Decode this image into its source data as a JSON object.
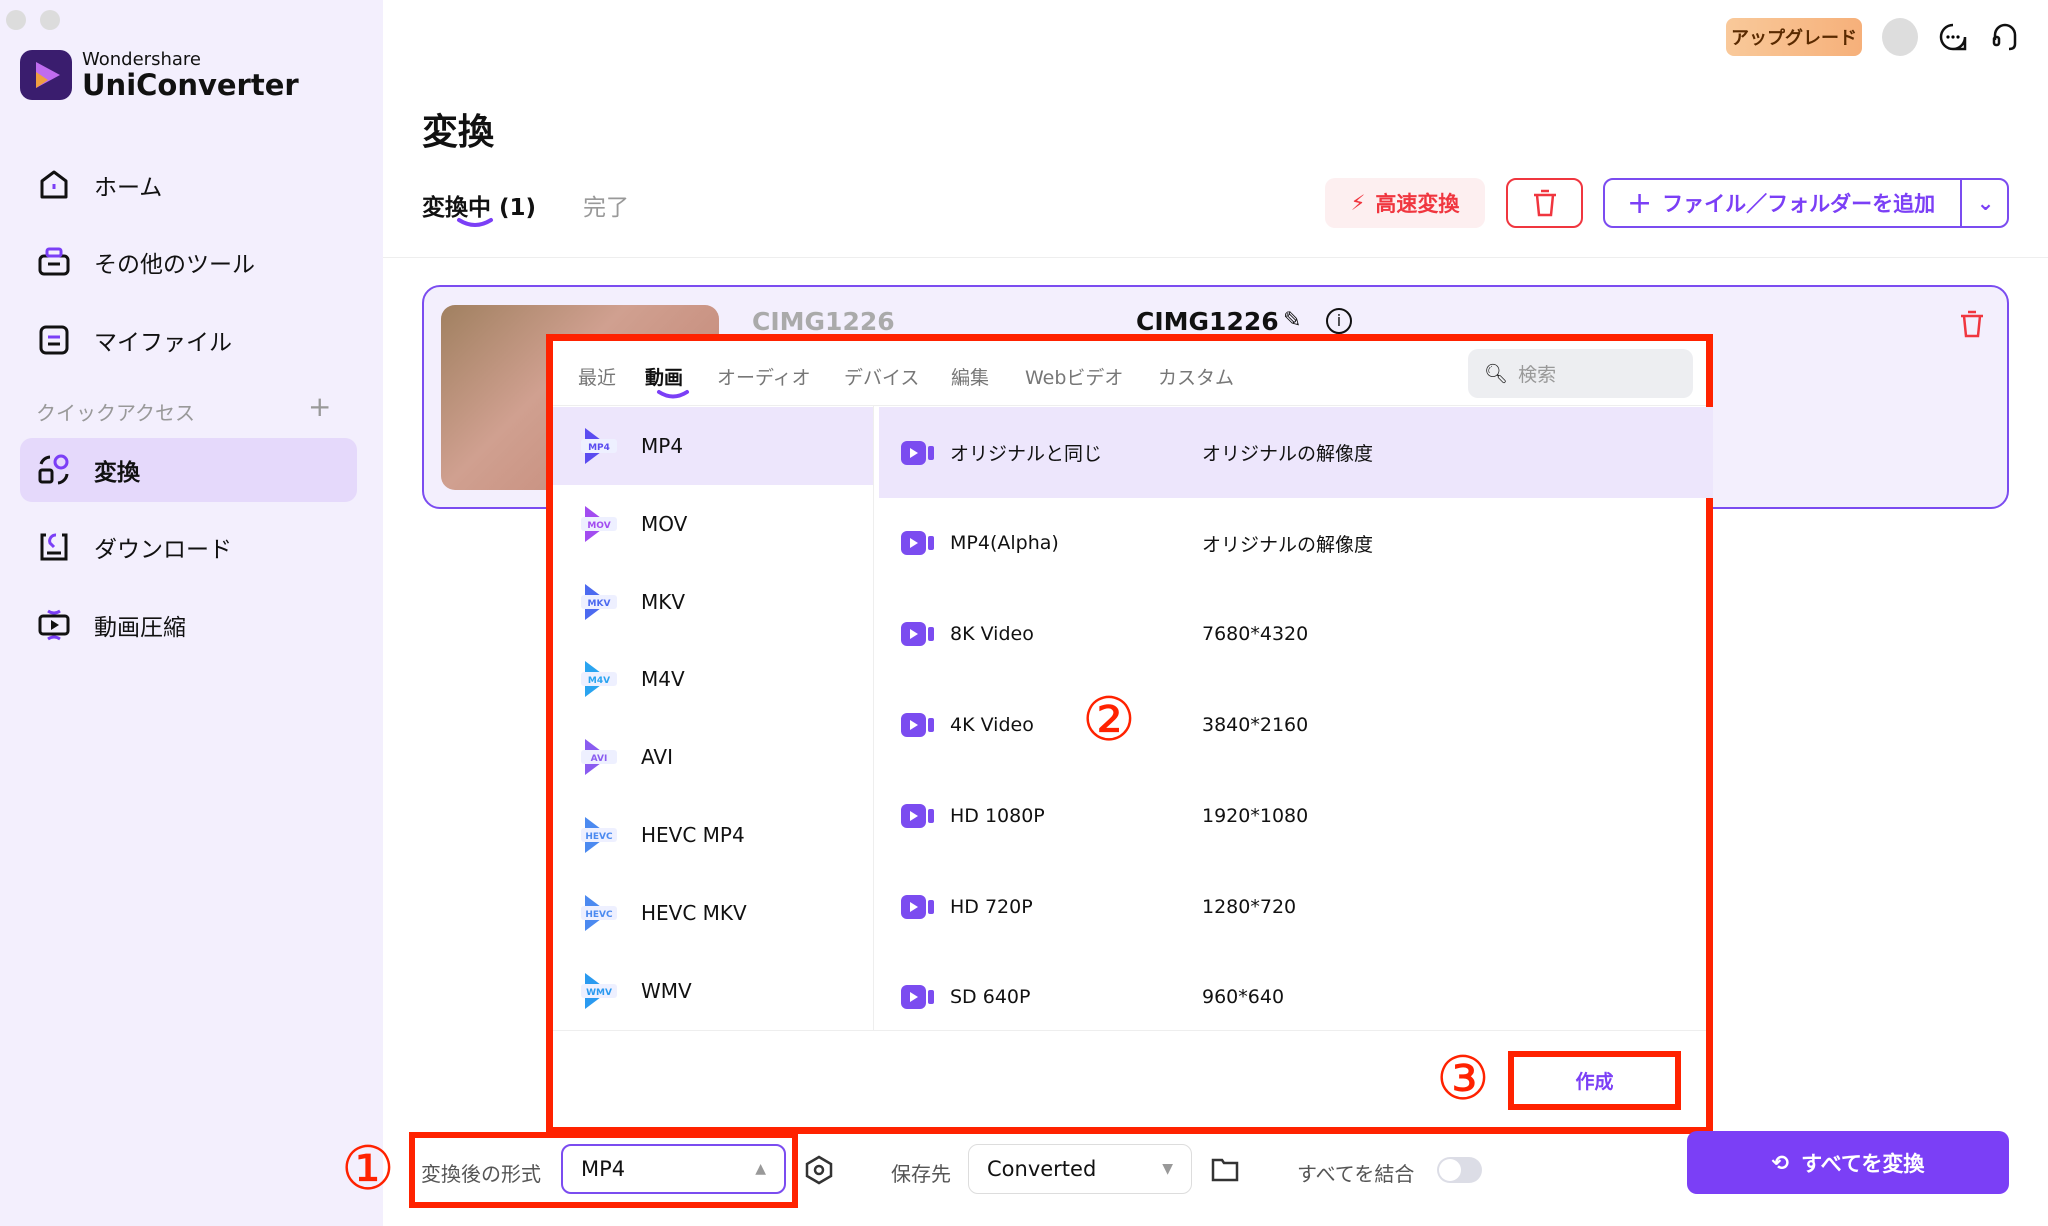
{
  "app": {
    "brand_top": "Wondershare",
    "brand_name": "UniConverter"
  },
  "sidebar": {
    "items": [
      {
        "label": "ホーム",
        "icon": "home-icon"
      },
      {
        "label": "その他のツール",
        "icon": "toolbox-icon"
      },
      {
        "label": "マイファイル",
        "icon": "file-icon"
      }
    ],
    "quick_access_label": "クイックアクセス",
    "quick_items": [
      {
        "label": "変換",
        "icon": "convert-icon",
        "selected": true
      },
      {
        "label": "ダウンロード",
        "icon": "download-icon"
      },
      {
        "label": "動画圧縮",
        "icon": "compress-icon"
      }
    ]
  },
  "header": {
    "upgrade": "アップグレード"
  },
  "main": {
    "title": "変換",
    "tabs": [
      {
        "label": "変換中 (1)",
        "active": true
      },
      {
        "label": "完了"
      }
    ],
    "fast_convert": "高速変換",
    "add_files": "ファイル／フォルダーを追加"
  },
  "file": {
    "source_name": "CIMG1226",
    "output_name": "CIMG1226"
  },
  "format_panel": {
    "tabs": [
      "最近",
      "動画",
      "オーディオ",
      "デバイス",
      "編集",
      "Webビデオ",
      "カスタム"
    ],
    "active_tab": "動画",
    "search_placeholder": "検索",
    "formats": [
      {
        "name": "MP4",
        "badge": "MP4",
        "color": "#5b4cf0"
      },
      {
        "name": "MOV",
        "badge": "MOV",
        "color": "#a24cf0"
      },
      {
        "name": "MKV",
        "badge": "MKV",
        "color": "#4c6af0"
      },
      {
        "name": "M4V",
        "badge": "M4V",
        "color": "#2aa4f0"
      },
      {
        "name": "AVI",
        "badge": "AVI",
        "color": "#8a5cf0"
      },
      {
        "name": "HEVC MP4",
        "badge": "HEVC",
        "color": "#4c8af0"
      },
      {
        "name": "HEVC MKV",
        "badge": "HEVC",
        "color": "#4c8af0"
      },
      {
        "name": "WMV",
        "badge": "WMV",
        "color": "#2a9af0"
      }
    ],
    "selected_format": "MP4",
    "presets": [
      {
        "name": "オリジナルと同じ",
        "res": "オリジナルの解像度"
      },
      {
        "name": "MP4(Alpha)",
        "res": "オリジナルの解像度"
      },
      {
        "name": "8K Video",
        "res": "7680*4320"
      },
      {
        "name": "4K Video",
        "res": "3840*2160"
      },
      {
        "name": "HD 1080P",
        "res": "1920*1080"
      },
      {
        "name": "HD 720P",
        "res": "1280*720"
      },
      {
        "name": "SD 640P",
        "res": "960*640"
      }
    ],
    "create_button": "作成"
  },
  "annotations": [
    "①",
    "②",
    "③"
  ],
  "bottom": {
    "format_label": "変換後の形式",
    "format_value": "MP4",
    "save_label": "保存先",
    "save_value": "Converted",
    "merge_label": "すべてを結合",
    "merge_on": false,
    "convert_all": "すべてを変換"
  },
  "colors": {
    "accent": "#7b3ff6",
    "danger": "#f0363f",
    "annotation": "#ff2200"
  }
}
